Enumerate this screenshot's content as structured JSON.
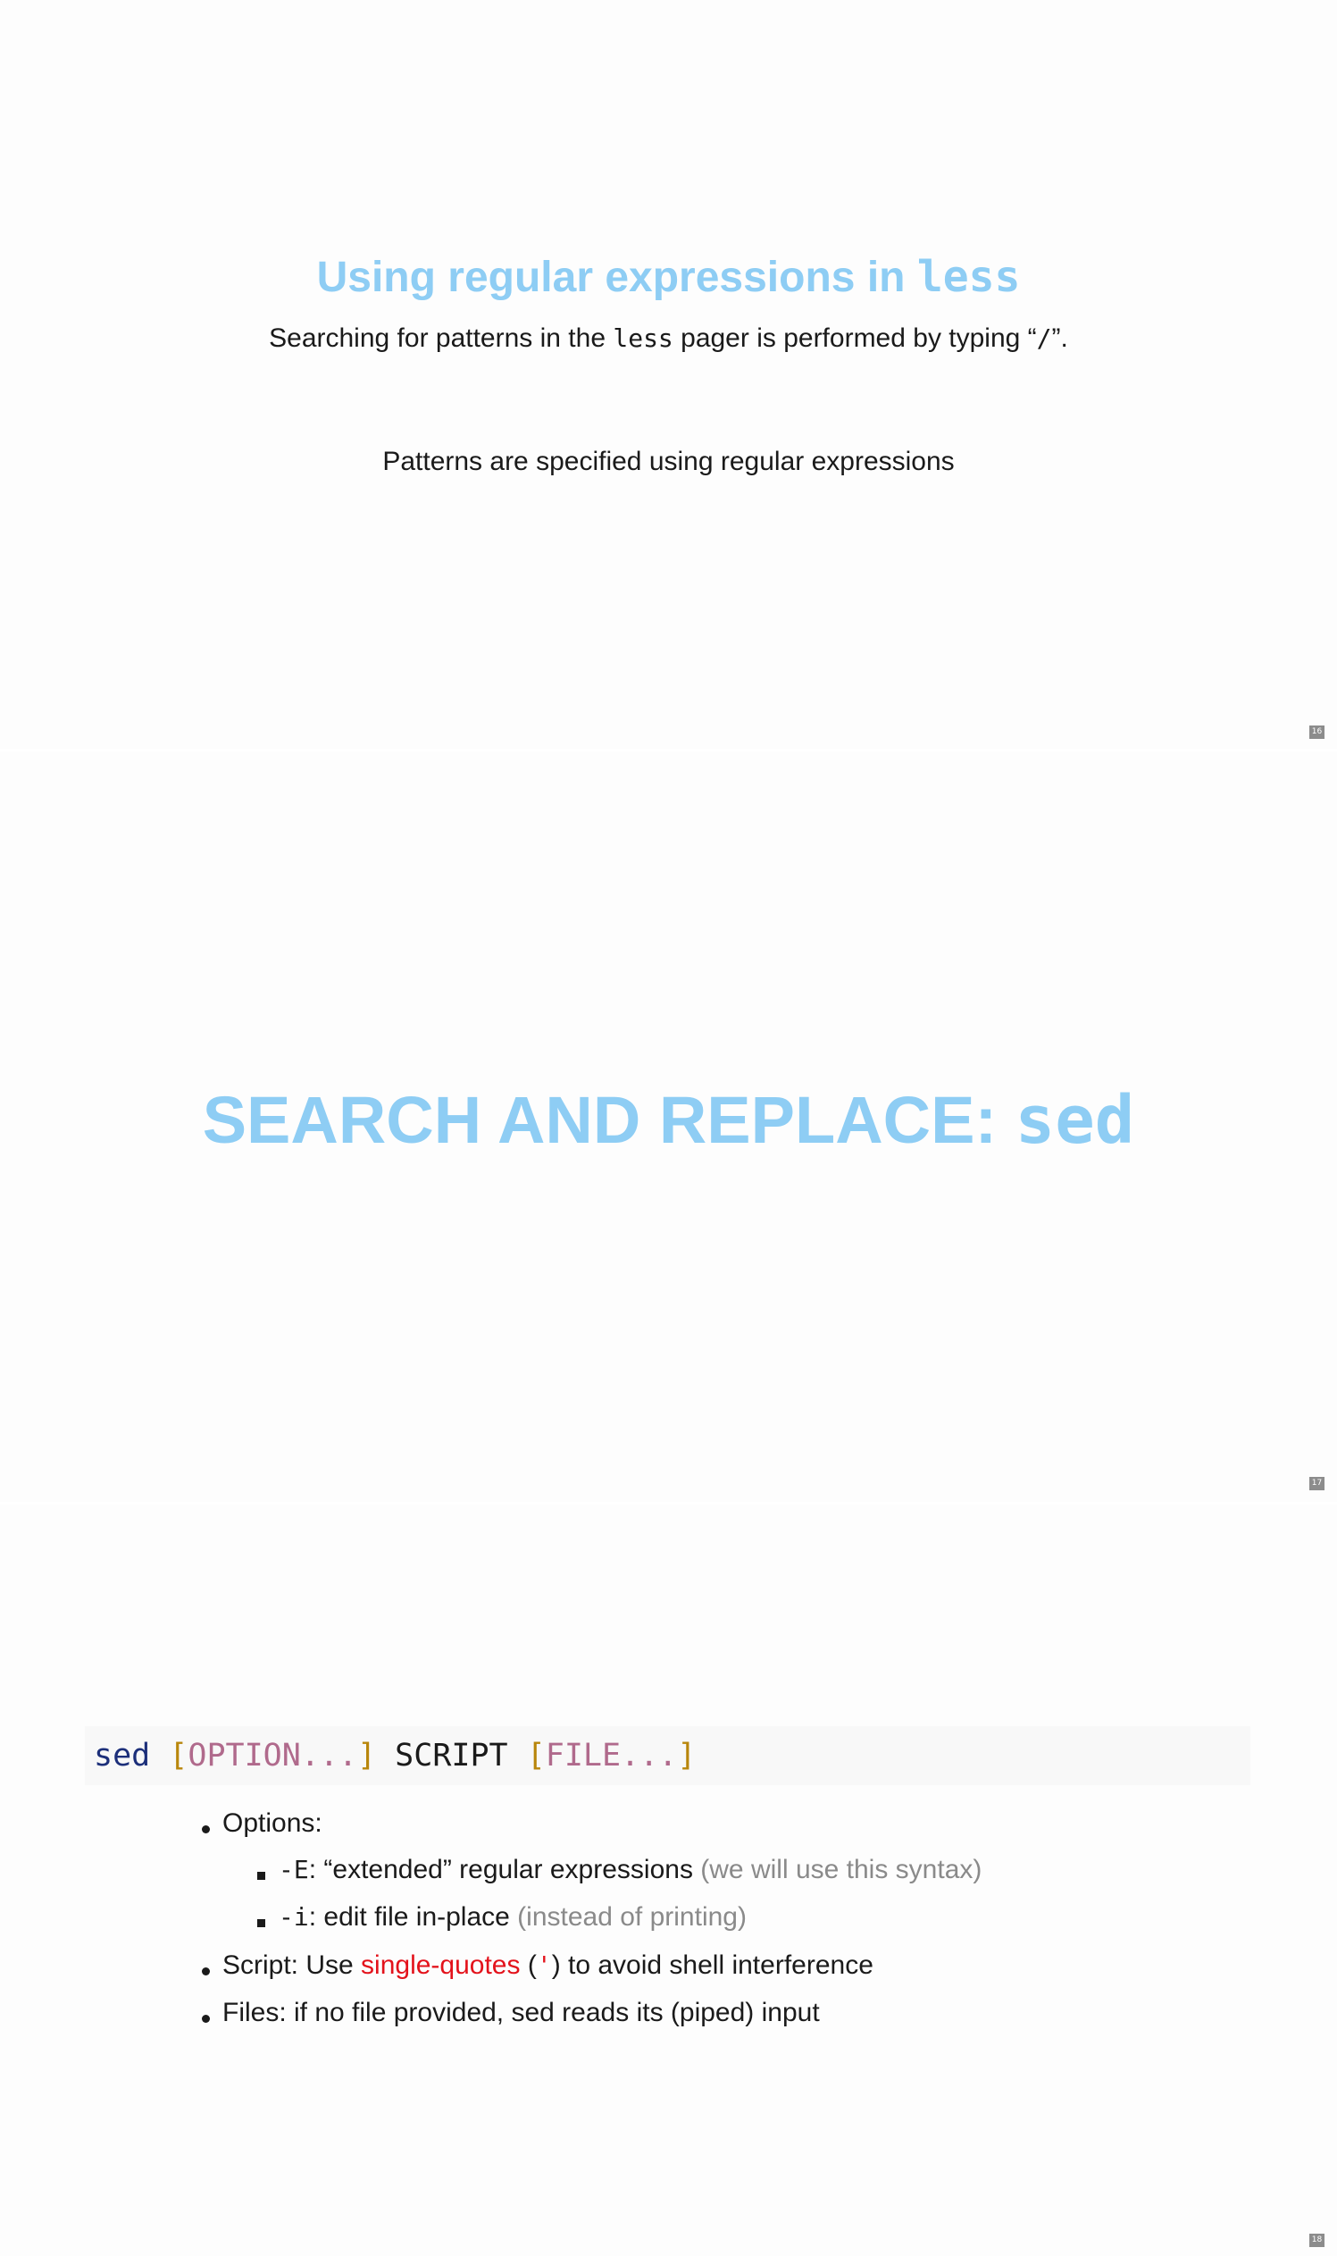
{
  "slides": [
    {
      "number": "16",
      "title_text": "Using regular expressions in ",
      "title_code": "less",
      "line1_before": "Searching for patterns in the ",
      "line1_code": "less",
      "line1_middle": " pager is performed by typing “",
      "line1_slash": "/",
      "line1_after": "”.",
      "line2": "Patterns are specified using regular expressions"
    },
    {
      "number": "17",
      "title_text": "SEARCH AND REPLACE: ",
      "title_code": "sed"
    },
    {
      "number": "18",
      "synopsis": {
        "cmd": "sed",
        "space1": " ",
        "option_open": "[",
        "option_text": "OPTION...",
        "option_close": "]",
        "script": " SCRIPT ",
        "file_open": "[",
        "file_text": "FILE...",
        "file_close": "]"
      },
      "options_label": "Options:",
      "opt_e_code": "-E",
      "opt_e_text": ": “extended” regular expressions ",
      "opt_e_note": "(we will use this syntax)",
      "opt_i_code": "-i",
      "opt_i_text": ": edit file in-place ",
      "opt_i_note": "(instead of printing)",
      "script_before": "Script: Use ",
      "script_red": "single-quotes",
      "script_paren_open": " (",
      "script_quote": "'",
      "script_after": ") to avoid shell interference",
      "files_text": "Files: if no file provided, sed reads its (piped) input"
    }
  ]
}
